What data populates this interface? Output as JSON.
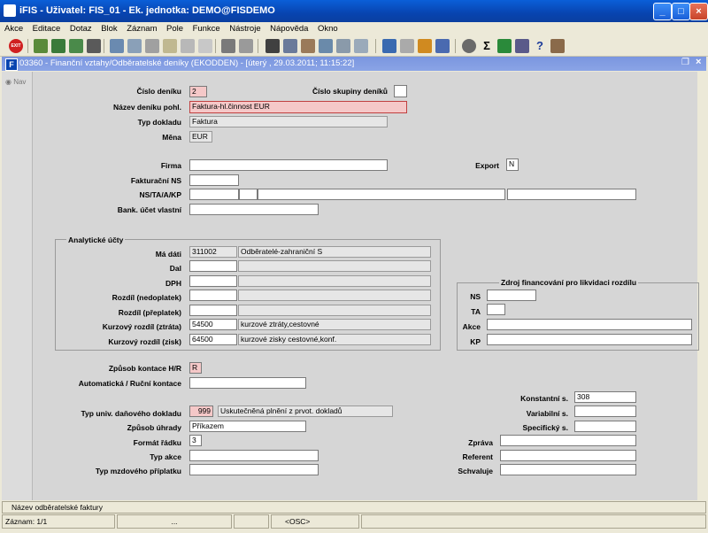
{
  "window": {
    "title": "iFIS - Uživatel: FIS_01 - Ek. jednotka: DEMO@FISDEMO"
  },
  "menu": [
    "Akce",
    "Editace",
    "Dotaz",
    "Blok",
    "Záznam",
    "Pole",
    "Funkce",
    "Nástroje",
    "Nápověda",
    "Okno"
  ],
  "toolbar": {
    "exit_label": "EXIT"
  },
  "inner_window": {
    "title": "03360 - Finanční vztahy/Odběratelské deníky (EKODDEN) - [úterý  , 29.03.2011; 11:15:22]",
    "icon": "F"
  },
  "leftnav": {
    "label": "Nav"
  },
  "form": {
    "cislo_deniku": {
      "label": "Číslo deníku",
      "value": "2"
    },
    "cislo_skupiny": {
      "label": "Číslo skupiny deníků",
      "value": ""
    },
    "nazev_deniku": {
      "label": "Název deníku pohl.",
      "value": "Faktura-hl.činnost EUR"
    },
    "typ_dokladu": {
      "label": "Typ dokladu",
      "value": "Faktura"
    },
    "mena": {
      "label": "Měna",
      "value": "EUR"
    },
    "firma": {
      "label": "Firma",
      "value": ""
    },
    "export": {
      "label": "Export",
      "value": "N"
    },
    "fakturacni_ns": {
      "label": "Fakturační NS",
      "value": ""
    },
    "ns_ta_a_kp": {
      "label": "NS/TA/A/KP",
      "values": [
        "",
        "",
        "",
        ""
      ]
    },
    "bank_ucet": {
      "label": "Bank. účet vlastní",
      "value": ""
    },
    "analyticke": {
      "title": "Analytické účty",
      "rows": [
        {
          "label": "Má dáti",
          "code": "311002",
          "desc": "Odběratelé-zahraniční          S"
        },
        {
          "label": "Dal",
          "code": "",
          "desc": ""
        },
        {
          "label": "DPH",
          "code": "",
          "desc": ""
        },
        {
          "label": "Rozdíl (nedoplatek)",
          "code": "",
          "desc": ""
        },
        {
          "label": "Rozdíl (přeplatek)",
          "code": "",
          "desc": ""
        },
        {
          "label": "Kurzový rozdíl (ztráta)",
          "code": "54500",
          "desc": "kurzové ztráty,cestovné"
        },
        {
          "label": "Kurzový rozdíl (zisk)",
          "code": "64500",
          "desc": "kurzové zisky cestovné,konf."
        }
      ]
    },
    "zdroj": {
      "title": "Zdroj financování pro likvidaci rozdílu",
      "ns": {
        "label": "NS",
        "value": ""
      },
      "ta": {
        "label": "TA",
        "value": ""
      },
      "akce": {
        "label": "Akce",
        "value": ""
      },
      "kp": {
        "label": "KP",
        "value": ""
      }
    },
    "zpusob_kontace": {
      "label": "Způsob kontace H/R",
      "value": "R"
    },
    "auto_rucni": {
      "label": "Automatická / Ruční kontace",
      "value": ""
    },
    "typ_univ": {
      "label": "Typ univ. daňového dokladu",
      "code": "999",
      "desc": "Uskutečněná plnění z prvot. dokladů"
    },
    "zpusob_uhrady": {
      "label": "Způsob úhrady",
      "value": "Příkazem"
    },
    "format_radku": {
      "label": "Formát řádku",
      "value": "3"
    },
    "typ_akce": {
      "label": "Typ akce",
      "value": ""
    },
    "typ_mzdoveho": {
      "label": "Typ mzdového příplatku",
      "value": ""
    },
    "konstantni": {
      "label": "Konstantní s.",
      "value": "308"
    },
    "variabilni": {
      "label": "Variabilní s.",
      "value": ""
    },
    "specificky": {
      "label": "Specifický s.",
      "value": ""
    },
    "zprava": {
      "label": "Zpráva",
      "value": ""
    },
    "referent": {
      "label": "Referent",
      "value": ""
    },
    "schvaluje": {
      "label": "Schvaluje",
      "value": ""
    }
  },
  "hint": "Název odběratelské faktury",
  "status": {
    "record": "Záznam: 1/1",
    "mid": "...",
    "osc": "<OSC>"
  }
}
